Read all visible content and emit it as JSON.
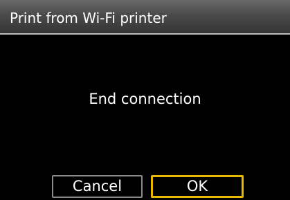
{
  "dialog": {
    "title": "Print from Wi-Fi printer",
    "message": "End connection",
    "buttons": {
      "cancel_label": "Cancel",
      "ok_label": "OK",
      "selected": "OK"
    }
  },
  "colors": {
    "background": "#000000",
    "title_bar": "#4a4a4a",
    "focus_border": "#e8b800",
    "button_border": "#8a8a8a"
  }
}
